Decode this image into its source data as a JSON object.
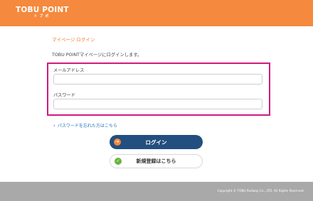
{
  "header": {
    "logo_text": "TOBU POINT",
    "logo_sub": "トブポ",
    "bg_color": "#f5893d"
  },
  "breadcrumb": "マイページ ログイン",
  "intro": "TOBU POINTマイページにログインします。",
  "form": {
    "email_label": "メールアドレス",
    "email_value": "",
    "password_label": "パスワード",
    "password_value": ""
  },
  "forgot_link": "パスワードを忘れた方はこちら",
  "buttons": {
    "login_label": "ログイン",
    "login_icon": "arrow-right-icon",
    "register_label": "新規登録はこちら",
    "register_icon": "check-icon"
  },
  "footer": {
    "copyright": "Copyright © TOBU Railway Co., LTD. All Rights Reserved."
  }
}
